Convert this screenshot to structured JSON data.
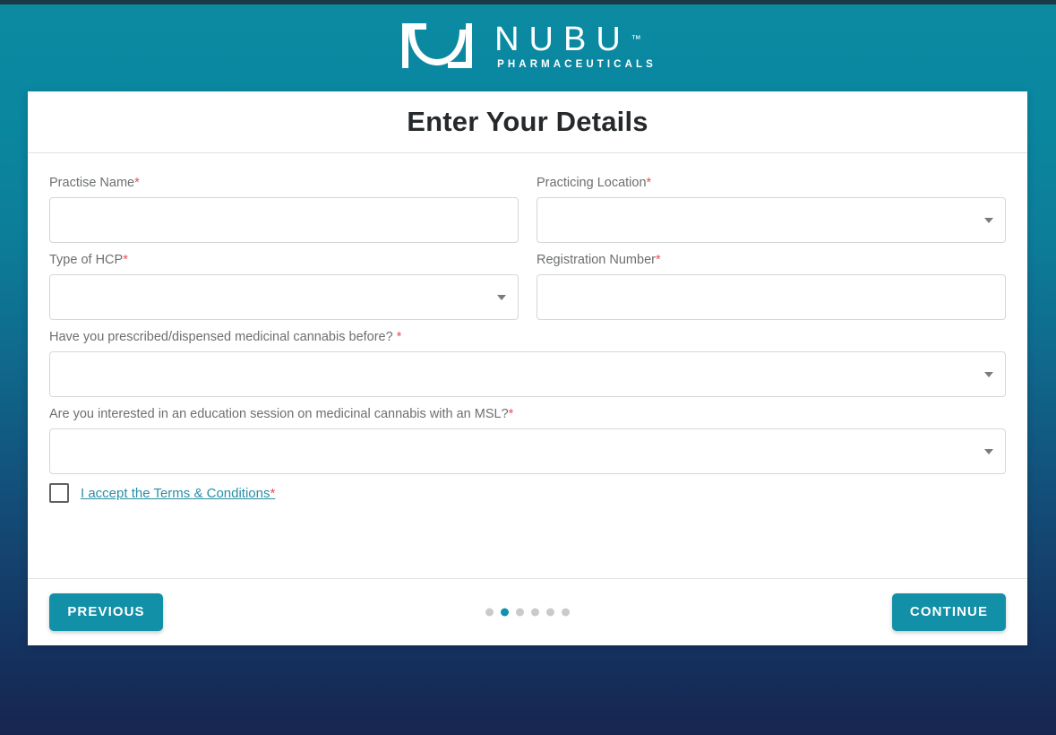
{
  "brand": {
    "mark": "nubu-logo-mark",
    "name": "NUBU",
    "trademark": "™",
    "subtitle": "PHARMACEUTICALS"
  },
  "colors": {
    "accent": "#1290a8",
    "accent_dot": "#0d93ad",
    "required": "#e8505b",
    "link": "#2a8fa5",
    "bg_top": "#0b8aa2",
    "bg_bottom": "#16264f",
    "card_bg": "#ffffff"
  },
  "card": {
    "title": "Enter Your Details"
  },
  "form": {
    "fields": [
      {
        "name": "practise-name",
        "label": "Practise Name",
        "required": true,
        "required_mark": "*",
        "control": "text",
        "value": "",
        "placeholder": ""
      },
      {
        "name": "practicing-location",
        "label": "Practicing Location",
        "required": true,
        "required_mark": "*",
        "control": "select",
        "value": "",
        "placeholder": ""
      },
      {
        "name": "type-of-hcp",
        "label": "Type of HCP",
        "required": true,
        "required_mark": "*",
        "control": "select",
        "value": "",
        "placeholder": ""
      },
      {
        "name": "registration-number",
        "label": "Registration Number",
        "required": true,
        "required_mark": "*",
        "control": "text",
        "value": "",
        "placeholder": ""
      },
      {
        "name": "prescribed-cannabis-before",
        "label": "Have you prescribed/dispensed medicinal cannabis before? ",
        "required": true,
        "required_mark": "*",
        "control": "select",
        "value": "",
        "placeholder": ""
      },
      {
        "name": "education-session-msl",
        "label": "Are you interested in an education session on medicinal cannabis with an MSL?",
        "required": true,
        "required_mark": "*",
        "control": "select",
        "value": "",
        "placeholder": ""
      }
    ],
    "terms": {
      "checked": false,
      "link_text": "I accept the Terms & Conditions",
      "required_mark": "*"
    }
  },
  "footer": {
    "previous_label": "PREVIOUS",
    "continue_label": "CONTINUE",
    "steps": {
      "total": 6,
      "active_index": 1
    }
  }
}
